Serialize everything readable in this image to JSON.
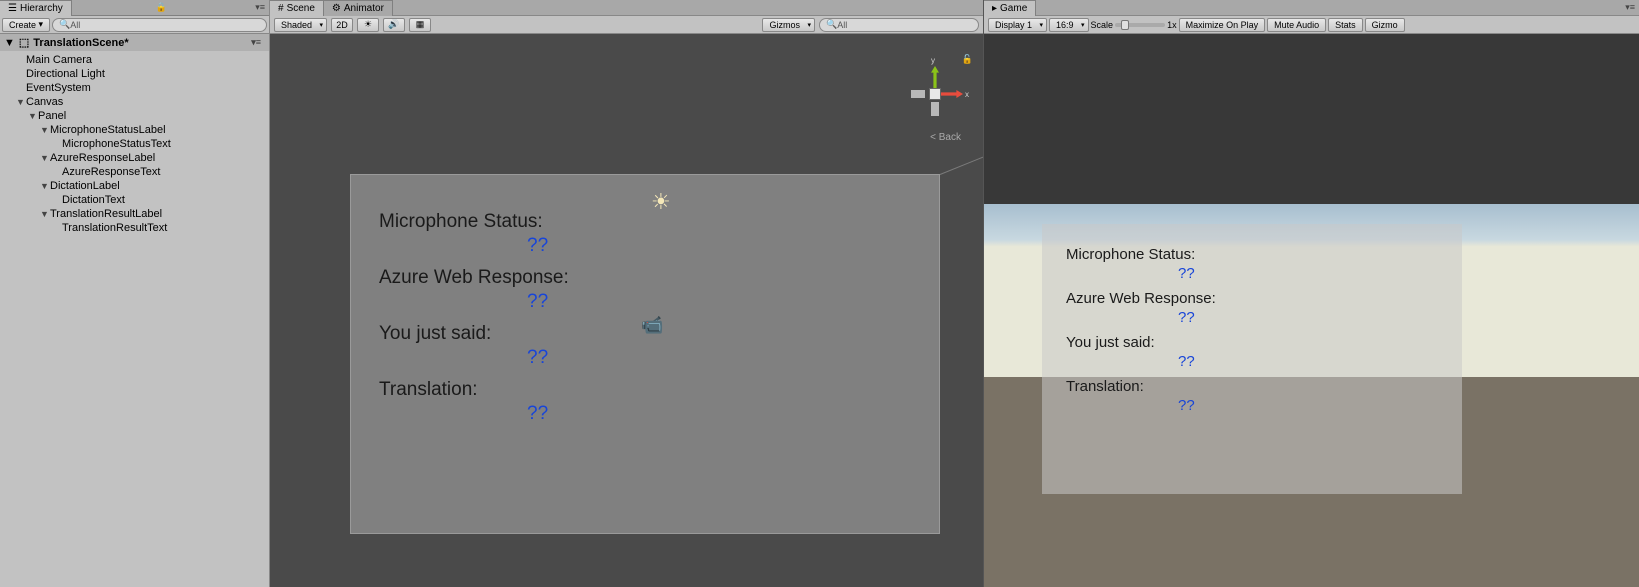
{
  "hierarchy": {
    "tab_label": "Hierarchy",
    "create_label": "Create",
    "search_placeholder": "All",
    "scene_name": "TranslationScene*",
    "items": [
      {
        "label": "Main Camera",
        "indent": 1,
        "arrow": ""
      },
      {
        "label": "Directional Light",
        "indent": 1,
        "arrow": ""
      },
      {
        "label": "EventSystem",
        "indent": 1,
        "arrow": ""
      },
      {
        "label": "Canvas",
        "indent": 1,
        "arrow": "▼"
      },
      {
        "label": "Panel",
        "indent": 2,
        "arrow": "▼"
      },
      {
        "label": "MicrophoneStatusLabel",
        "indent": 3,
        "arrow": "▼"
      },
      {
        "label": "MicrophoneStatusText",
        "indent": 4,
        "arrow": ""
      },
      {
        "label": "AzureResponseLabel",
        "indent": 3,
        "arrow": "▼"
      },
      {
        "label": "AzureResponseText",
        "indent": 4,
        "arrow": ""
      },
      {
        "label": "DictationLabel",
        "indent": 3,
        "arrow": "▼"
      },
      {
        "label": "DictationText",
        "indent": 4,
        "arrow": ""
      },
      {
        "label": "TranslationResultLabel",
        "indent": 3,
        "arrow": "▼"
      },
      {
        "label": "TranslationResultText",
        "indent": 4,
        "arrow": ""
      }
    ]
  },
  "scene": {
    "tab_label": "Scene",
    "animator_tab": "Animator",
    "shading_mode": "Shaded",
    "btn_2d": "2D",
    "gizmos_label": "Gizmos",
    "search_placeholder": "All",
    "gizmo_back": "< Back",
    "gizmo_y": "y",
    "gizmo_x": "x"
  },
  "canvas_ui": {
    "mic_label": "Microphone Status:",
    "mic_value": "??",
    "azure_label": "Azure Web Response:",
    "azure_value": "??",
    "said_label": "You just said:",
    "said_value": "??",
    "trans_label": "Translation:",
    "trans_value": "??"
  },
  "game": {
    "tab_label": "Game",
    "display": "Display 1",
    "aspect": "16:9",
    "scale_label": "Scale",
    "scale_value": "1x",
    "maximize": "Maximize On Play",
    "mute": "Mute Audio",
    "stats": "Stats",
    "gizmos": "Gizmo"
  }
}
